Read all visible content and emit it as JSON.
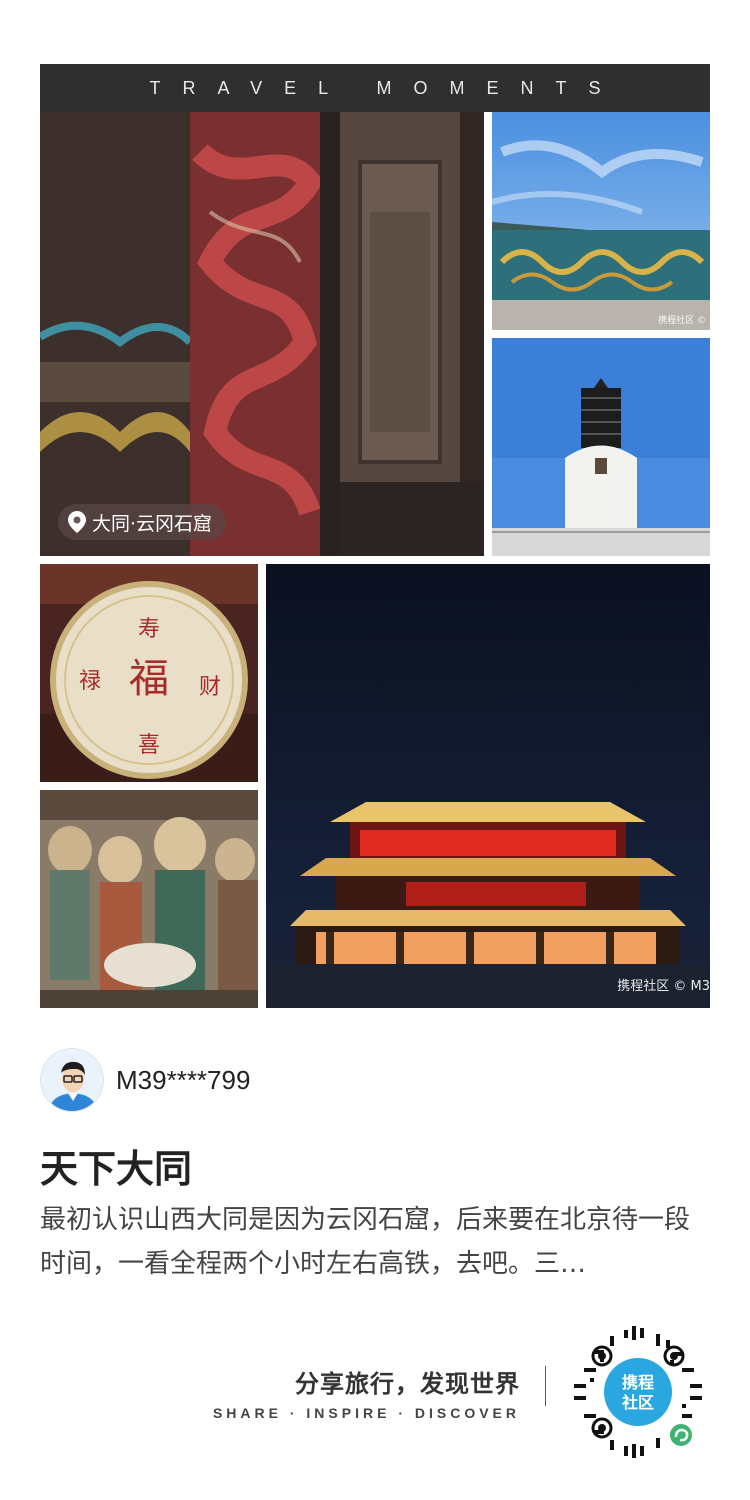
{
  "header": {
    "title": "TRAVEL MOMENTS"
  },
  "photos": {
    "location_badge": "大同·云冈石窟",
    "watermark_small": "携程社区 ©",
    "watermark_large": "携程社区 © M3"
  },
  "user": {
    "name": "M39****799"
  },
  "post": {
    "title": "天下大同",
    "body": "最初认识山西大同是因为云冈石窟，后来要在北京待一段时间，一看全程两个小时左右高铁，去吧。三…"
  },
  "footer": {
    "slogan_cn": "分享旅行，发现世界",
    "slogan_en": "SHARE · INSPIRE · DISCOVER",
    "qr_label": "携程社区"
  },
  "colors": {
    "header_bg": "#2f2f2f",
    "qr_center": "#2aa7e0",
    "qr_badge": "#3cb371"
  }
}
